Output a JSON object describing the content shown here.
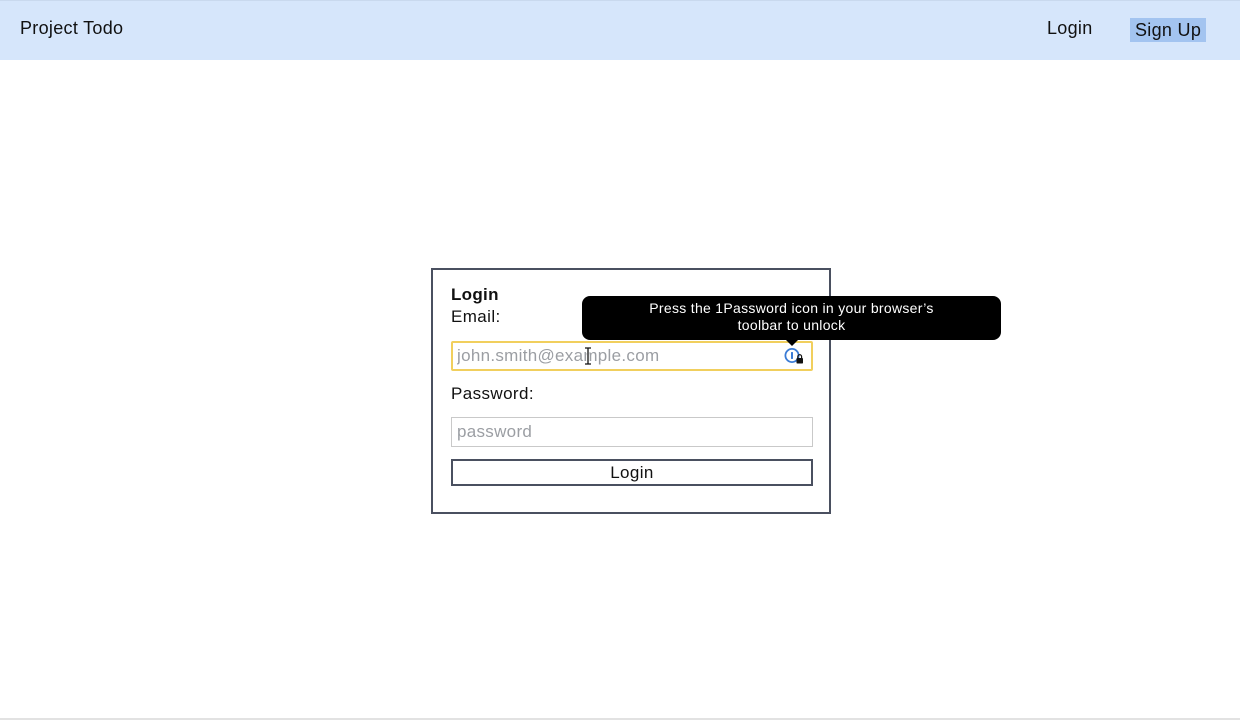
{
  "nav": {
    "brand": "Project Todo",
    "login_label": "Login",
    "signup_label": "Sign Up"
  },
  "form": {
    "title": "Login",
    "email_label": "Email:",
    "email_value": "",
    "email_placeholder": "john.smith@example.com",
    "password_label": "Password:",
    "password_value": "",
    "password_placeholder": "password",
    "submit_label": "Login"
  },
  "tooltip": {
    "line1": "Press the 1Password icon in your browser’s",
    "line2": "toolbar to unlock"
  },
  "icons": {
    "password_manager": "1password-locked-icon",
    "cursor": "text-cursor-icon"
  },
  "colors": {
    "navbar_bg": "#d6e6fb",
    "signup_highlight": "#a3c4f0",
    "focus_border": "#f1cf5d",
    "card_border": "#4a5060",
    "tooltip_bg": "#000000",
    "onepw_blue": "#3a7bd5"
  }
}
